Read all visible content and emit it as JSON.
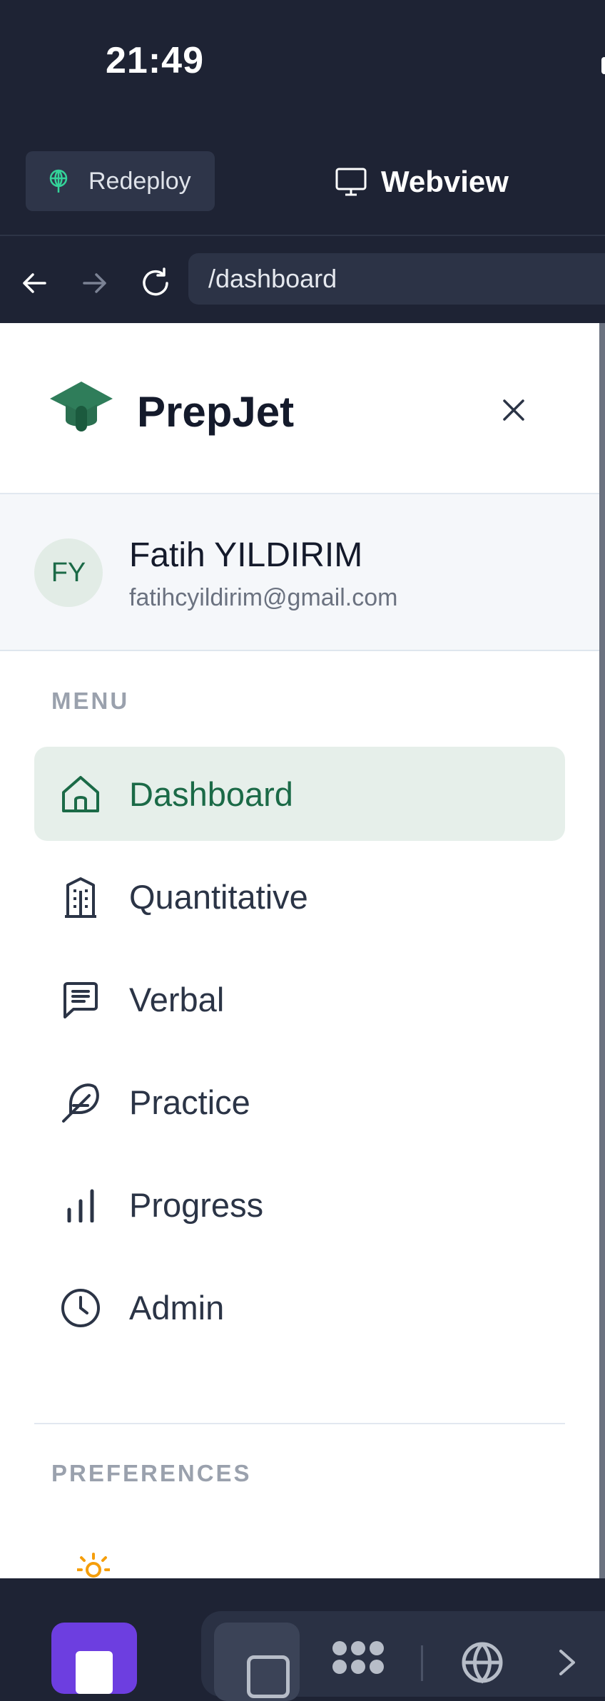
{
  "status": {
    "time": "21:49"
  },
  "toolbar": {
    "redeploy_label": "Redeploy",
    "webview_label": "Webview"
  },
  "navbar": {
    "url": "/dashboard"
  },
  "brand": {
    "name": "PrepJet"
  },
  "user": {
    "initials": "FY",
    "name": "Fatih YILDIRIM",
    "email": "fatihcyildirim@gmail.com"
  },
  "menu": {
    "section_label": "MENU",
    "items": [
      {
        "label": "Dashboard",
        "icon": "home-icon",
        "active": true
      },
      {
        "label": "Quantitative",
        "icon": "building-icon",
        "active": false
      },
      {
        "label": "Verbal",
        "icon": "message-square-icon",
        "active": false
      },
      {
        "label": "Practice",
        "icon": "feather-icon",
        "active": false
      },
      {
        "label": "Progress",
        "icon": "bar-chart-icon",
        "active": false
      },
      {
        "label": "Admin",
        "icon": "clock-icon",
        "active": false
      }
    ]
  },
  "preferences": {
    "section_label": "PREFERENCES",
    "icon": "sun-icon"
  },
  "colors": {
    "brand_green": "#1b6a47",
    "active_bg": "#e6efea",
    "chrome_dark": "#1e2334",
    "app_purple": "#6d3ee0",
    "sun_orange": "#f59e0b"
  }
}
